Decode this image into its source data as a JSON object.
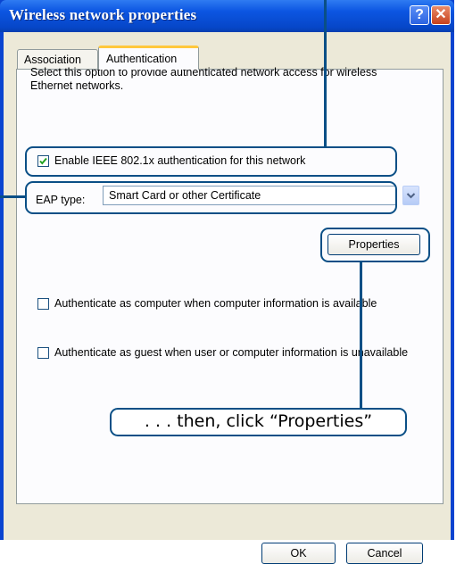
{
  "window": {
    "title": "Wireless network properties",
    "help_symbol": "?",
    "close_symbol": "✕"
  },
  "tabs": [
    {
      "label": "Association",
      "active": false
    },
    {
      "label": "Authentication",
      "active": true
    }
  ],
  "description": "Select this option to provide authenticated network access for wireless Ethernet networks.",
  "enable_8021x": {
    "label": "Enable IEEE 802.1x authentication for this network",
    "checked": true
  },
  "eap": {
    "label": "EAP type:",
    "selected": "Smart Card or other Certificate"
  },
  "properties_button": "Properties",
  "auth_as_computer": {
    "label": "Authenticate as computer when computer information is available",
    "checked": false
  },
  "auth_as_guest": {
    "label": "Authenticate as guest when user or computer information is unavailable",
    "checked": false
  },
  "callout_text": ". . . then, click “Properties”",
  "footer": {
    "ok": "OK",
    "cancel": "Cancel"
  },
  "colors": {
    "titlebar": "#0a56e2",
    "dialog_bg": "#ece9d8",
    "callout": "#0a4f86",
    "active_tab_accent": "#ffc83c"
  }
}
